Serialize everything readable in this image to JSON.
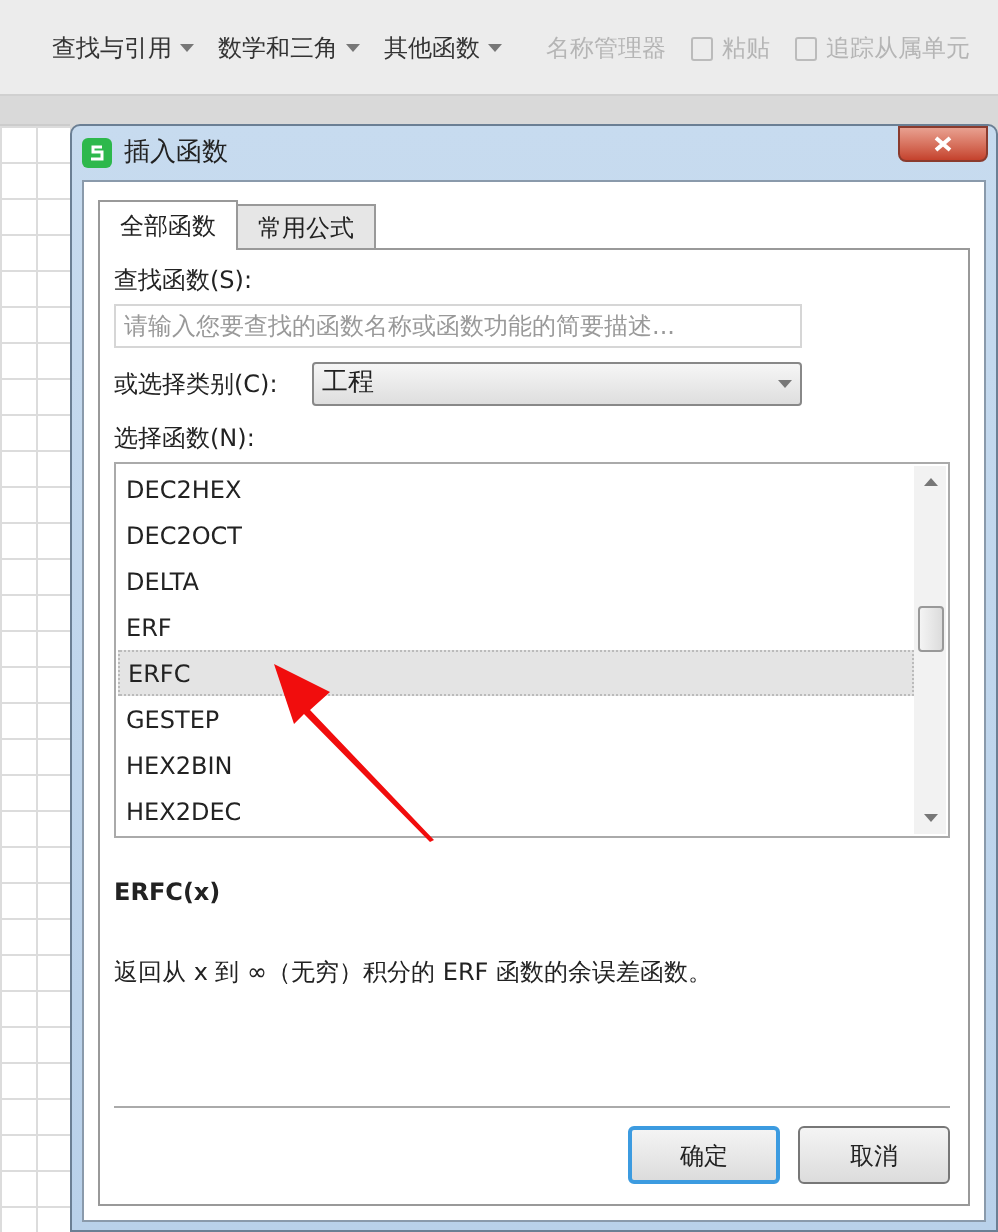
{
  "ribbon": {
    "groups": [
      {
        "label": "查找与引用",
        "disabled": false
      },
      {
        "label": "数学和三角",
        "disabled": false
      },
      {
        "label": "其他函数",
        "disabled": false
      },
      {
        "label": "名称管理器",
        "disabled": true
      }
    ],
    "small_buttons": [
      {
        "label": "粘贴",
        "disabled": true
      },
      {
        "label": "追踪从属单元",
        "disabled": true
      }
    ]
  },
  "dialog": {
    "title": "插入函数",
    "tabs": [
      {
        "label": "全部函数",
        "selected": true
      },
      {
        "label": "常用公式",
        "selected": false
      }
    ],
    "search": {
      "label": "查找函数(S):",
      "placeholder": "请输入您要查找的函数名称或函数功能的简要描述..."
    },
    "category": {
      "label": "或选择类别(C):",
      "value": "工程"
    },
    "list_label": "选择函数(N):",
    "functions": [
      {
        "name": "DEC2HEX",
        "selected": false
      },
      {
        "name": "DEC2OCT",
        "selected": false
      },
      {
        "name": "DELTA",
        "selected": false
      },
      {
        "name": "ERF",
        "selected": false
      },
      {
        "name": "ERFC",
        "selected": true
      },
      {
        "name": "GESTEP",
        "selected": false
      },
      {
        "name": "HEX2BIN",
        "selected": false
      },
      {
        "name": "HEX2DEC",
        "selected": false
      }
    ],
    "signature": "ERFC(x)",
    "description": "返回从 x 到 ∞（无穷）积分的 ERF 函数的余误差函数。",
    "buttons": [
      {
        "label": "确定",
        "kind": "primary"
      },
      {
        "label": "取消",
        "kind": "secondary"
      }
    ]
  }
}
